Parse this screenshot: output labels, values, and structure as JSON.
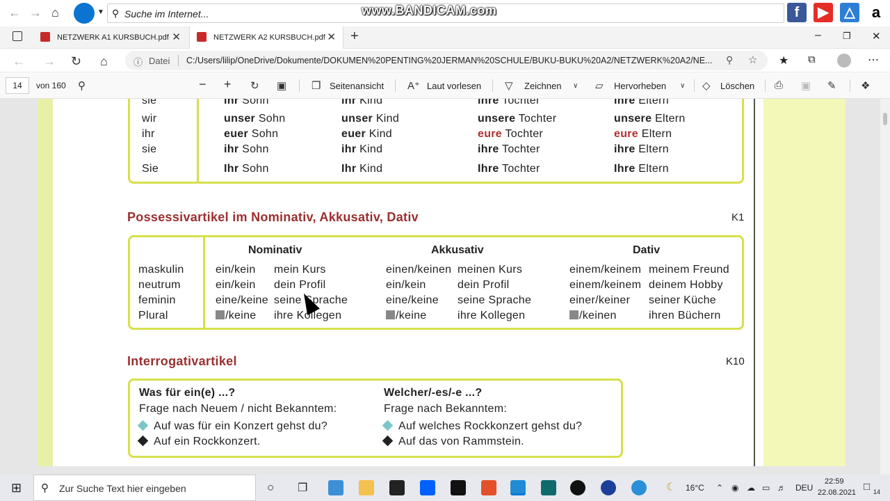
{
  "browser": {
    "search_placeholder": "Suche im Internet...",
    "watermark": "www.BANDICAM.com",
    "tabs": [
      {
        "label": "NETZWERK A1 KURSBUCH.pdf"
      },
      {
        "label": "NETZWERK A2 KURSBUCH.pdf"
      }
    ],
    "address": {
      "scheme_label": "Datei",
      "url": "C:/Users/lilip/OneDrive/Dokumente/DOKUMEN%20PENTING%20JERMAN%20SCHULE/BUKU-BUKU%20A2/NETZWERK%20A2/NE..."
    }
  },
  "pdf_toolbar": {
    "page_number": "14",
    "page_total": "von 160",
    "page_view": "Seitenansicht",
    "read_aloud": "Laut vorlesen",
    "draw": "Zeichnen",
    "highlight": "Hervorheben",
    "erase": "Löschen"
  },
  "possessive_table": {
    "rows": [
      {
        "p": "sie",
        "m": "ihr",
        "mn": "Sohn",
        "n": "ihr",
        "nn": "Kind",
        "f": "ihre",
        "fn": "Tochter",
        "pl": "ihre",
        "pln": "Eltern"
      },
      {
        "p": "wir",
        "m": "unser",
        "mn": "Sohn",
        "n": "unser",
        "nn": "Kind",
        "f": "unsere",
        "fn": "Tochter",
        "pl": "unsere",
        "pln": "Eltern"
      },
      {
        "p": "ihr",
        "m": "euer",
        "mn": "Sohn",
        "n": "euer",
        "nn": "Kind",
        "f": "eure",
        "fn": "Tochter",
        "pl": "eure",
        "pln": "Eltern"
      },
      {
        "p": "sie",
        "m": "ihr",
        "mn": "Sohn",
        "n": "ihr",
        "nn": "Kind",
        "f": "ihre",
        "fn": "Tochter",
        "pl": "ihre",
        "pln": "Eltern"
      },
      {
        "p": "Sie",
        "m": "Ihr",
        "mn": "Sohn",
        "n": "Ihr",
        "nn": "Kind",
        "f": "Ihre",
        "fn": "Tochter",
        "pl": "Ihre",
        "pln": "Eltern"
      }
    ]
  },
  "section1": {
    "title": "Possessivartikel im Nominativ, Akkusativ, Dativ",
    "ref": "K1",
    "headers": [
      "Nominativ",
      "Akkusativ",
      "Dativ"
    ],
    "genders": [
      "maskulin",
      "neutrum",
      "feminin",
      "Plural"
    ],
    "nom_a": [
      "ein/kein",
      "ein/kein",
      "eine/keine",
      "/keine"
    ],
    "nom_b": [
      "mein Kurs",
      "dein Profil",
      "seine Sprache",
      "ihre Kollegen"
    ],
    "akk_a": [
      "einen/keinen",
      "ein/kein",
      "eine/keine",
      "/keine"
    ],
    "akk_b": [
      "meinen Kurs",
      "dein Profil",
      "seine Sprache",
      "ihre Kollegen"
    ],
    "dat_a": [
      "einem/keinem",
      "einem/keinem",
      "einer/keiner",
      "/keinen"
    ],
    "dat_b": [
      "meinem Freund",
      "deinem Hobby",
      "seiner Küche",
      "ihren Büchern"
    ]
  },
  "section2": {
    "title": "Interrogativartikel",
    "ref": "K10",
    "left_title": "Was für ein(e) ...?",
    "left_sub": "Frage nach Neuem / nicht Bekanntem:",
    "left_q": "Auf was für ein Konzert gehst du?",
    "left_a": "Auf ein Rockkonzert.",
    "right_title": "Welcher/-es/-e ...?",
    "right_sub": "Frage nach Bekanntem:",
    "right_q": "Auf welches Rockkonzert gehst du?",
    "right_a": "Auf das von Rammstein."
  },
  "taskbar": {
    "search_placeholder": "Zur Suche Text hier eingeben",
    "temperature": "16°C",
    "language": "DEU",
    "time": "22:59",
    "date": "22.08.2021",
    "notifications": "14"
  },
  "colors": {
    "accent_border": "#d7e04b",
    "heading": "#9b2f2f",
    "brand_edge": "#0078d4"
  }
}
